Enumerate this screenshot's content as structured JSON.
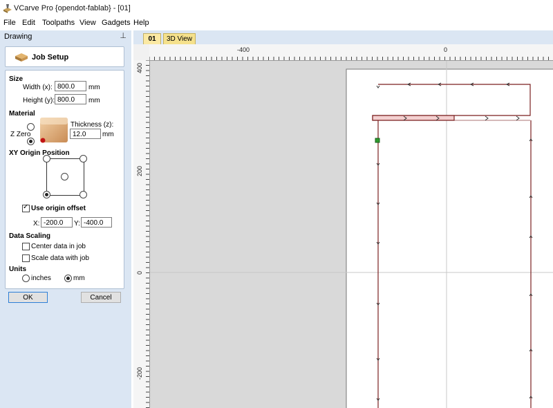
{
  "window": {
    "title": "VCarve Pro {opendot-fablab} - [01]",
    "app_icon": "vcarve-icon"
  },
  "menu": [
    "File",
    "Edit",
    "Toolpaths",
    "View",
    "Gadgets",
    "Help"
  ],
  "panel": {
    "title": "Drawing",
    "pin_icon": "pin-icon",
    "job_setup_label": "Job Setup",
    "size": {
      "heading": "Size",
      "width_label": "Width (x):",
      "width_value": "800.0",
      "width_unit": "mm",
      "height_label": "Height (y):",
      "height_value": "800.0",
      "height_unit": "mm"
    },
    "material": {
      "heading": "Material",
      "thickness_label": "Thickness (z):",
      "thickness_value": "12.0",
      "thickness_unit": "mm",
      "zzero_label": "Z Zero"
    },
    "origin": {
      "heading": "XY Origin Position",
      "use_offset_label": "Use origin offset",
      "use_offset_checked": true,
      "x_label": "X:",
      "x_value": "-200.0",
      "y_label": "Y:",
      "y_value": "-400.0"
    },
    "scaling": {
      "heading": "Data Scaling",
      "center_label": "Center data in job",
      "center_checked": false,
      "scale_label": "Scale data with job",
      "scale_checked": false
    },
    "units": {
      "heading": "Units",
      "inches_label": "inches",
      "mm_label": "mm",
      "selected": "mm"
    },
    "ok_label": "OK",
    "cancel_label": "Cancel"
  },
  "tabs": [
    {
      "label": "01",
      "active": true
    },
    {
      "label": "3D View",
      "active": false
    }
  ],
  "rulers": {
    "top_labels": [
      "-400",
      "0"
    ],
    "left_labels": [
      "400",
      "200",
      "0",
      "-200"
    ]
  },
  "colors": {
    "panel_bg": "#dbe6f3",
    "canvas_bg": "#d9d9d9",
    "sheet": "#ffffff",
    "vector": "#7a1f1f",
    "selected_node": "#2e9b2e"
  }
}
